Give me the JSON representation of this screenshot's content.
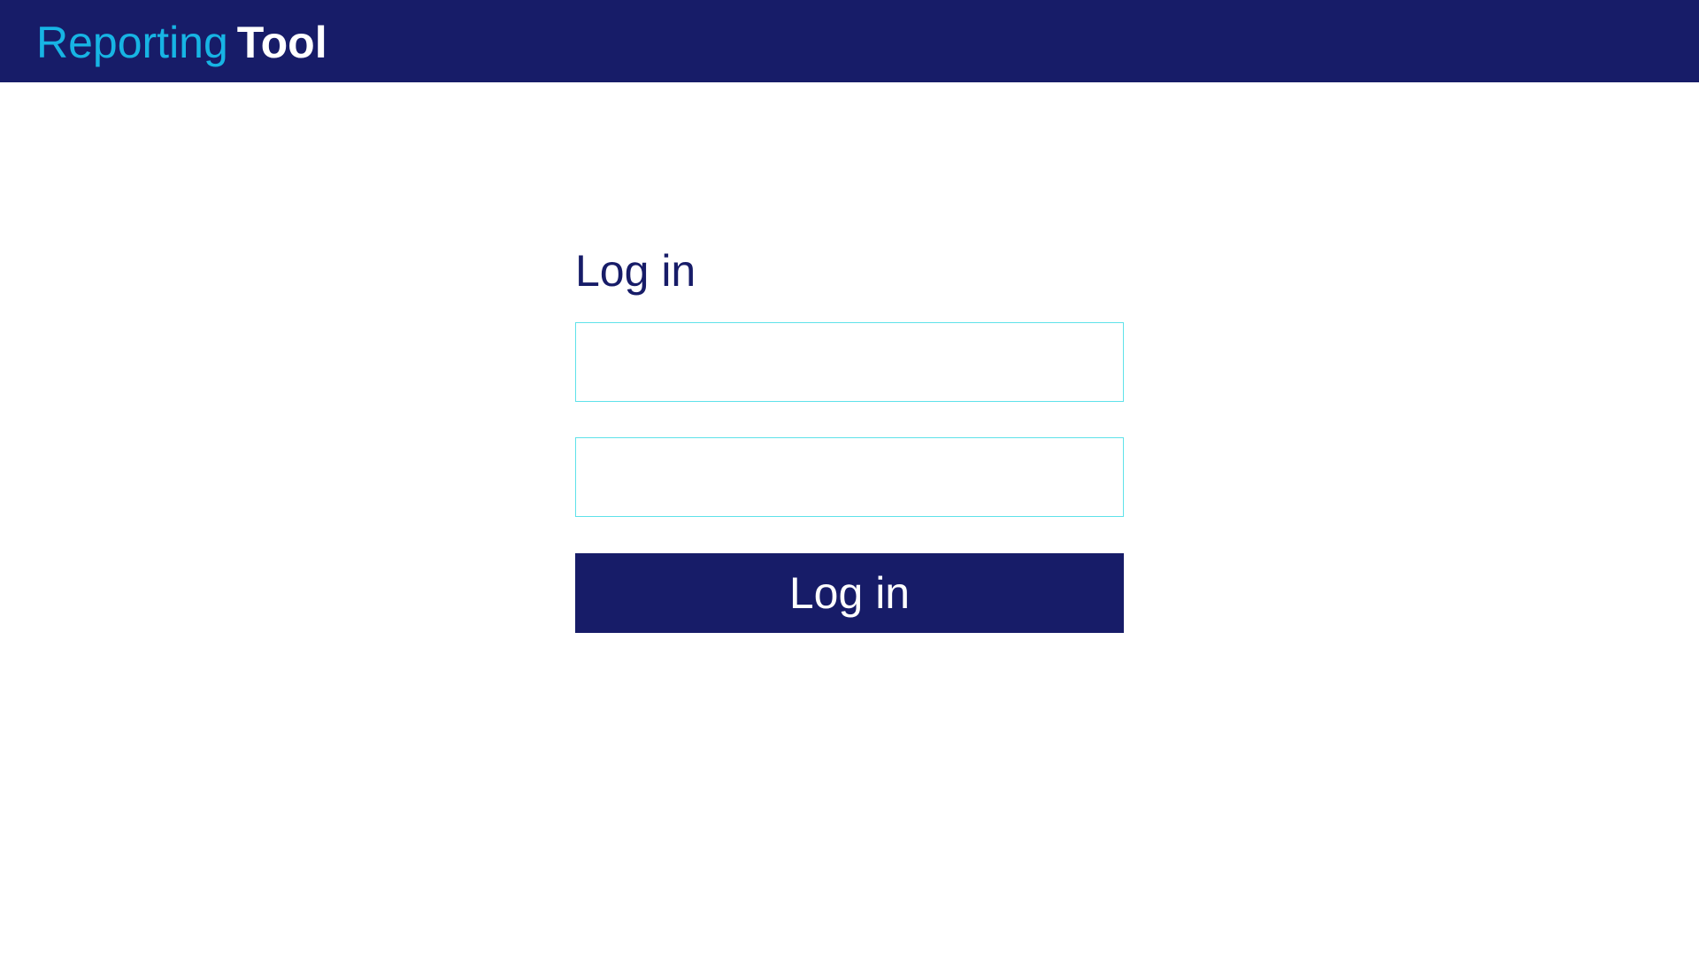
{
  "header": {
    "brand_light": "Reporting",
    "brand_bold": "Tool"
  },
  "login": {
    "title": "Log in",
    "username": {
      "value": "",
      "placeholder": ""
    },
    "password": {
      "value": "",
      "placeholder": ""
    },
    "submit_label": "Log in"
  },
  "colors": {
    "header_bg": "#171c68",
    "brand_accent": "#17b4e4",
    "field_border": "#5fe2ea",
    "button_bg": "#171c68",
    "title_text": "#171c68"
  }
}
